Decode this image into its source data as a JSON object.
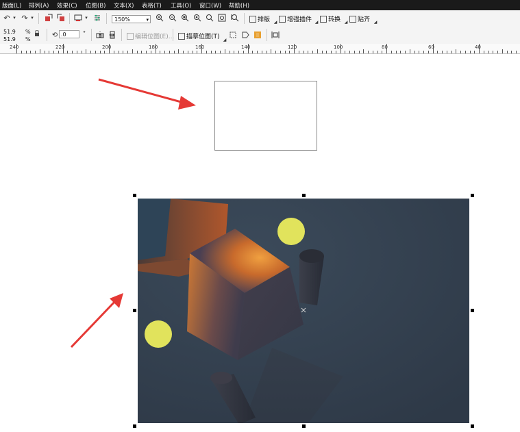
{
  "menu": {
    "items": [
      "版面(L)",
      "排列(A)",
      "效果(C)",
      "位图(B)",
      "文本(X)",
      "表格(T)",
      "工具(O)",
      "窗口(W)",
      "帮助(H)"
    ]
  },
  "toolbar": {
    "zoom_value": "150%",
    "layout_label": "排版",
    "plugins_label": "增强插件",
    "convert_label": "转换",
    "align_label": "贴齐"
  },
  "propertybar": {
    "width_value": "51.9",
    "height_value": "51.9",
    "percent_unit_1": "%",
    "percent_unit_2": "%",
    "rotation_value": ".0",
    "degree_unit": "°",
    "edit_bitmap_label": "编辑位图(E)...",
    "trace_bitmap_label": "描摹位图(T)"
  },
  "ruler": {
    "labels": [
      "240",
      "220",
      "200",
      "180",
      "160",
      "140",
      "120",
      "100",
      "80",
      "60",
      "40"
    ]
  },
  "colors": {
    "menubar_bg": "#1a1a1a",
    "arrow_red": "#e53935",
    "photo_bg": "#34404e",
    "sphere_yellow": "#e1e35c",
    "cube_orange": "#e0822c"
  }
}
